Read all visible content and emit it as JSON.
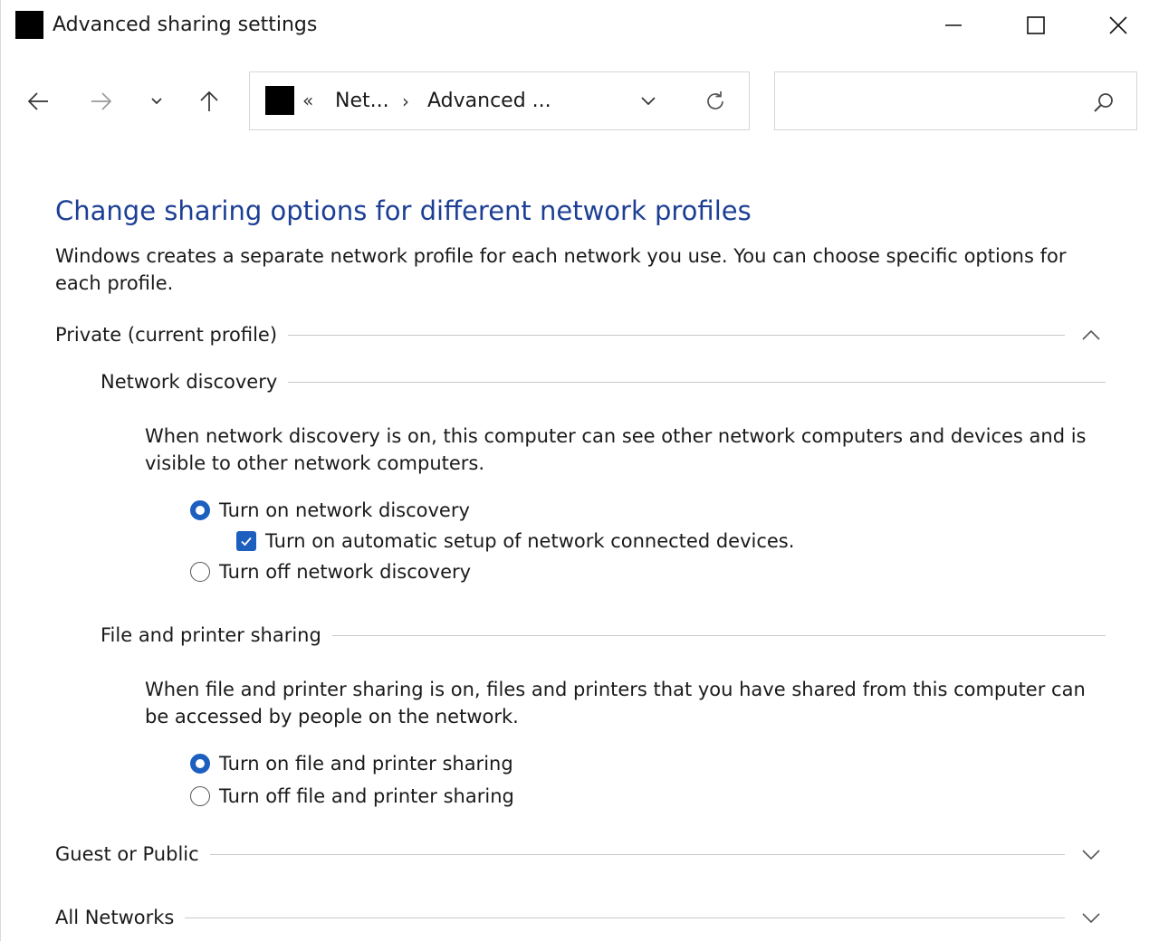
{
  "window": {
    "title": "Advanced sharing settings"
  },
  "address_bar": {
    "overflow_glyph": "«",
    "crumbs": [
      "Net...",
      "Advanced ..."
    ],
    "separator": "›"
  },
  "search": {
    "value": "",
    "placeholder": ""
  },
  "icons": {
    "back": "arrow-left-icon",
    "forward": "arrow-right-icon",
    "recent": "chevron-down-icon",
    "up": "arrow-up-icon",
    "refresh": "refresh-icon",
    "search": "search-icon",
    "minimize": "minimize-icon",
    "maximize": "maximize-icon",
    "close": "close-icon"
  },
  "colors": {
    "title_blue": "#1c3f95",
    "accent": "#1c5fbf"
  },
  "content": {
    "title": "Change sharing options for different network profiles",
    "intro": "Windows creates a separate network profile for each network you use. You can choose specific options for each profile.",
    "profiles": {
      "private": {
        "label": "Private (current profile)",
        "expanded": true,
        "network_discovery": {
          "heading": "Network discovery",
          "description": "When network discovery is on, this computer can see other network computers and devices and is visible to other network computers.",
          "on_label": "Turn on network discovery",
          "auto_setup_label": "Turn on automatic setup of network connected devices.",
          "off_label": "Turn off network discovery",
          "selected": "on",
          "auto_setup_checked": true
        },
        "file_printer_sharing": {
          "heading": "File and printer sharing",
          "description": "When file and printer sharing is on, files and printers that you have shared from this computer can be accessed by people on the network.",
          "on_label": "Turn on file and printer sharing",
          "off_label": "Turn off file and printer sharing",
          "selected": "on"
        }
      },
      "guest": {
        "label": "Guest or Public",
        "expanded": false
      },
      "all": {
        "label": "All Networks",
        "expanded": false
      }
    }
  }
}
